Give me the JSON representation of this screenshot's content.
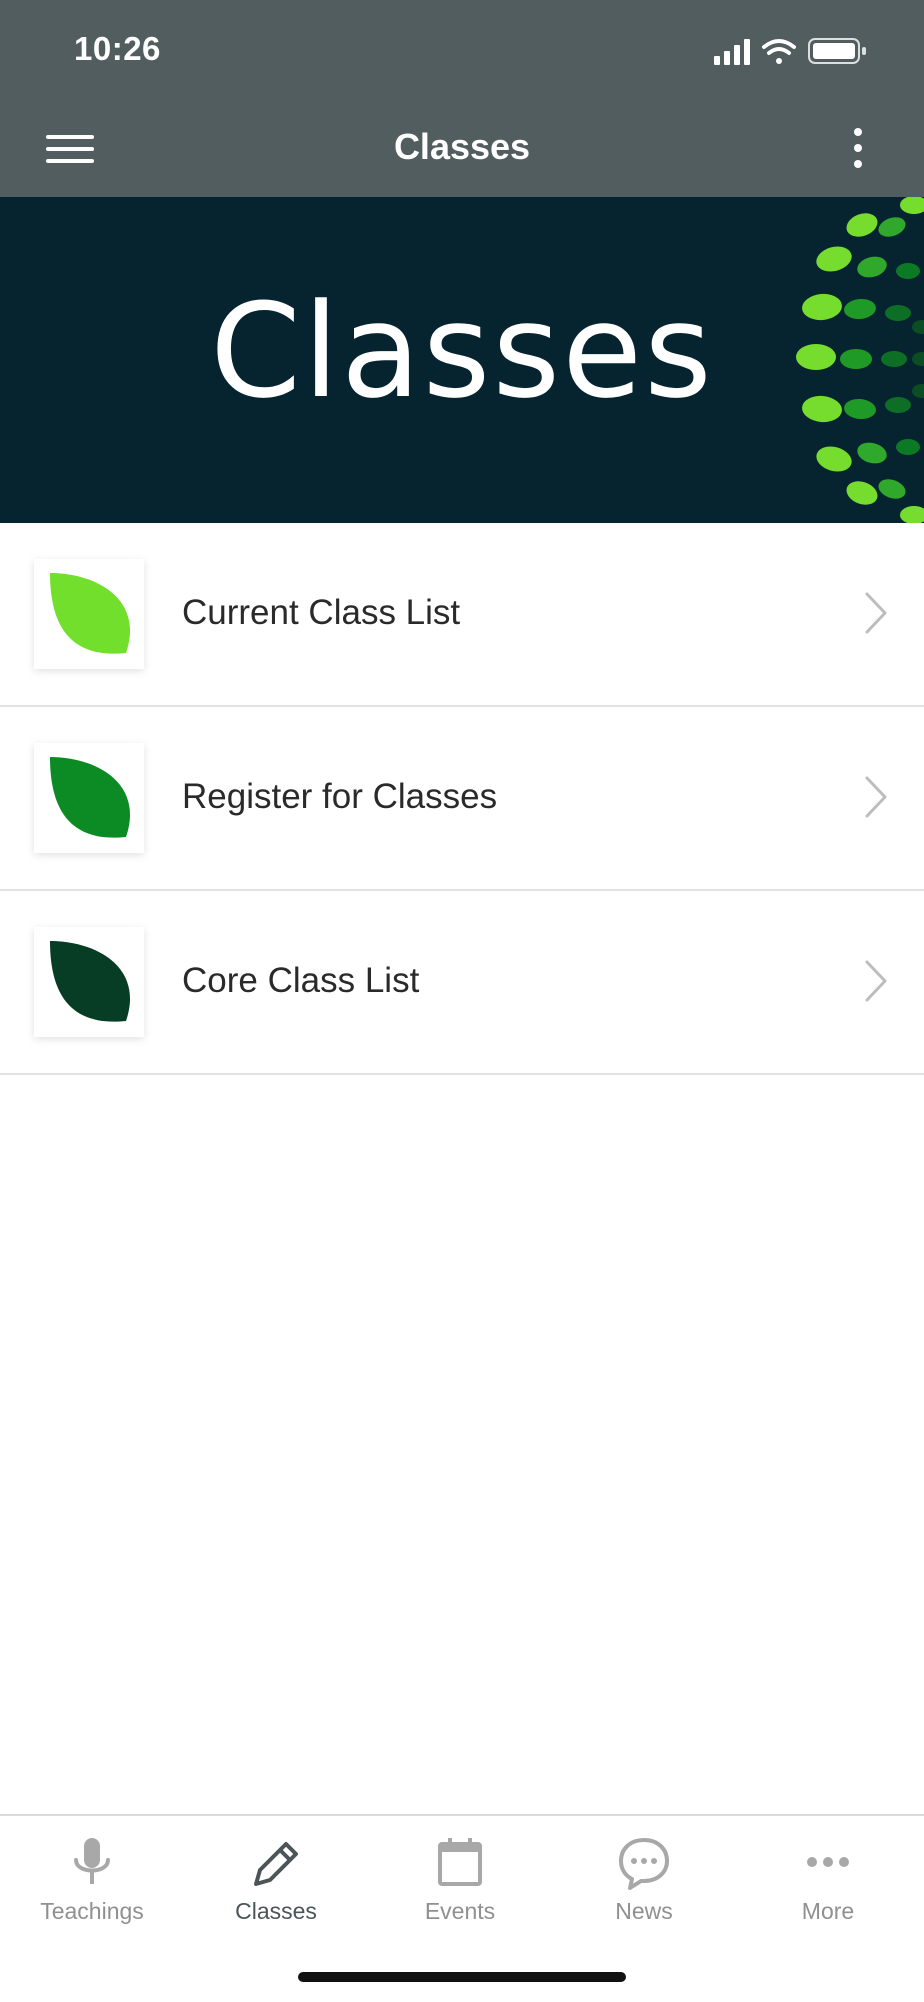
{
  "status_bar": {
    "time": "10:26"
  },
  "app_bar": {
    "title": "Classes"
  },
  "banner": {
    "title": "Classes"
  },
  "list": {
    "items": [
      {
        "label": "Current Class List",
        "leaf_color": "#72df2c"
      },
      {
        "label": "Register for Classes",
        "leaf_color": "#0c8a23"
      },
      {
        "label": "Core Class List",
        "leaf_color": "#073d25"
      }
    ]
  },
  "tab_bar": {
    "tabs": [
      {
        "label": "Teachings",
        "icon": "microphone-icon"
      },
      {
        "label": "Classes",
        "icon": "pencil-icon",
        "active": true
      },
      {
        "label": "Events",
        "icon": "calendar-icon"
      },
      {
        "label": "News",
        "icon": "chat-bubble-icon"
      },
      {
        "label": "More",
        "icon": "more-dots-icon"
      }
    ]
  },
  "colors": {
    "header_bg": "#525d60",
    "banner_bg": "#062430",
    "tab_active": "#4b5457",
    "tab_inactive": "#909090"
  }
}
